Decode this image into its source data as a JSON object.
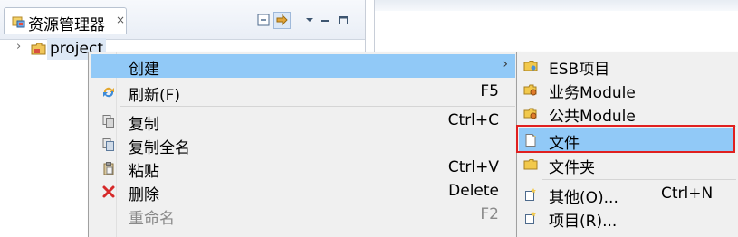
{
  "explorer": {
    "tab_title": "资源管理器",
    "tab_close": "×",
    "tree_item": "project"
  },
  "context_menu": {
    "items": [
      {
        "label": "创建",
        "shortcut": "",
        "icon": "none"
      },
      {
        "label": "刷新(F)",
        "shortcut": "F5",
        "icon": "refresh-icon"
      },
      {
        "label": "复制",
        "shortcut": "Ctrl+C",
        "icon": "copy-icon"
      },
      {
        "label": "复制全名",
        "shortcut": "",
        "icon": "copy-name-icon"
      },
      {
        "label": "粘贴",
        "shortcut": "Ctrl+V",
        "icon": "paste-icon"
      },
      {
        "label": "删除",
        "shortcut": "Delete",
        "icon": "delete-icon"
      },
      {
        "label": "重命名",
        "shortcut": "F2",
        "icon": "none"
      }
    ],
    "submenu_arrow": "›"
  },
  "submenu": {
    "items": [
      {
        "label": "ESB项目",
        "shortcut": "",
        "icon": "folder-icon"
      },
      {
        "label": "业务Module",
        "shortcut": "",
        "icon": "module-icon"
      },
      {
        "label": "公共Module",
        "shortcut": "",
        "icon": "module-icon"
      },
      {
        "label": "文件",
        "shortcut": "",
        "icon": "file-icon"
      },
      {
        "label": "文件夹",
        "shortcut": "",
        "icon": "folder-icon"
      },
      {
        "label": "其他(O)...",
        "shortcut": "Ctrl+N",
        "icon": "wizard-icon"
      },
      {
        "label": "项目(R)...",
        "shortcut": "",
        "icon": "wizard-icon"
      }
    ]
  },
  "colors": {
    "highlight": "#91c9f7",
    "annotation_box": "#e02020",
    "delete_icon": "#d62a2a"
  }
}
